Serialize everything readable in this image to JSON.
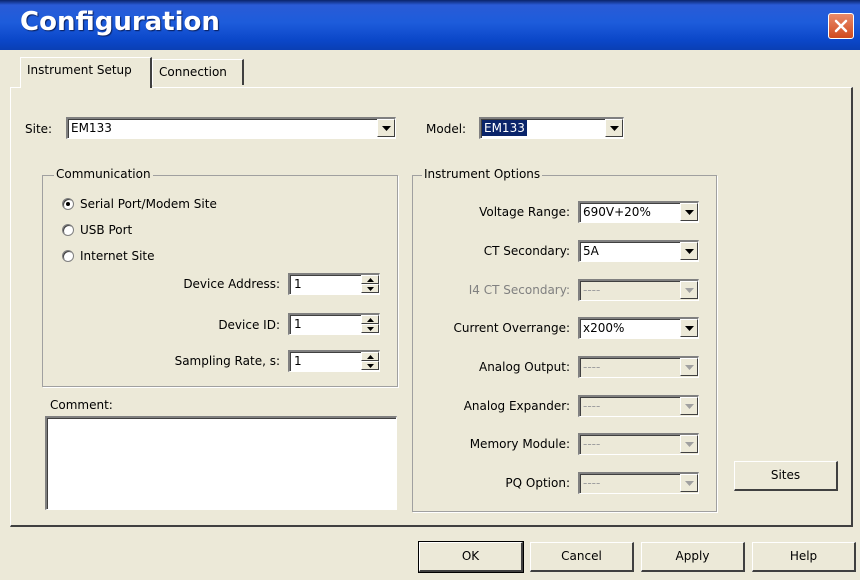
{
  "window": {
    "title": "Configuration"
  },
  "tabs": [
    {
      "label": "Instrument Setup",
      "active": true
    },
    {
      "label": "Connection",
      "active": false
    }
  ],
  "site": {
    "label": "Site:",
    "value": "EM133"
  },
  "model": {
    "label": "Model:",
    "value": "EM133"
  },
  "communication": {
    "title": "Communication",
    "options": [
      {
        "label": "Serial Port/Modem Site",
        "selected": true
      },
      {
        "label": "USB Port",
        "selected": false
      },
      {
        "label": "Internet Site",
        "selected": false
      }
    ],
    "fields": [
      {
        "label": "Device Address:",
        "value": "1"
      },
      {
        "label": "Device ID:",
        "value": "1"
      },
      {
        "label": "Sampling Rate, s:",
        "value": "1"
      }
    ]
  },
  "comment": {
    "label": "Comment:",
    "value": ""
  },
  "instrument_options": {
    "title": "Instrument Options",
    "fields": [
      {
        "label": "Voltage Range:",
        "value": "690V+20%",
        "enabled": true
      },
      {
        "label": "CT Secondary:",
        "value": "5A",
        "enabled": true
      },
      {
        "label": "I4 CT Secondary:",
        "value": "----",
        "enabled": false
      },
      {
        "label": "Current Overrange:",
        "value": "x200%",
        "enabled": true
      },
      {
        "label": "Analog Output:",
        "value": "----",
        "enabled": false
      },
      {
        "label": "Analog Expander:",
        "value": "----",
        "enabled": false
      },
      {
        "label": "Memory Module:",
        "value": "----",
        "enabled": false
      },
      {
        "label": "PQ Option:",
        "value": "----",
        "enabled": false
      }
    ]
  },
  "buttons": {
    "sites": "Sites",
    "ok": "OK",
    "cancel": "Cancel",
    "apply": "Apply",
    "help": "Help"
  },
  "colors": {
    "titlebar": "#0B47C9",
    "face": "#ECE9D8",
    "selection": "#0A246A",
    "close": "#D04A1E"
  },
  "icons": {
    "close": "close-icon",
    "dropdown": "chevron-down-icon",
    "spin_up": "spin-up-icon",
    "spin_down": "spin-down-icon"
  }
}
